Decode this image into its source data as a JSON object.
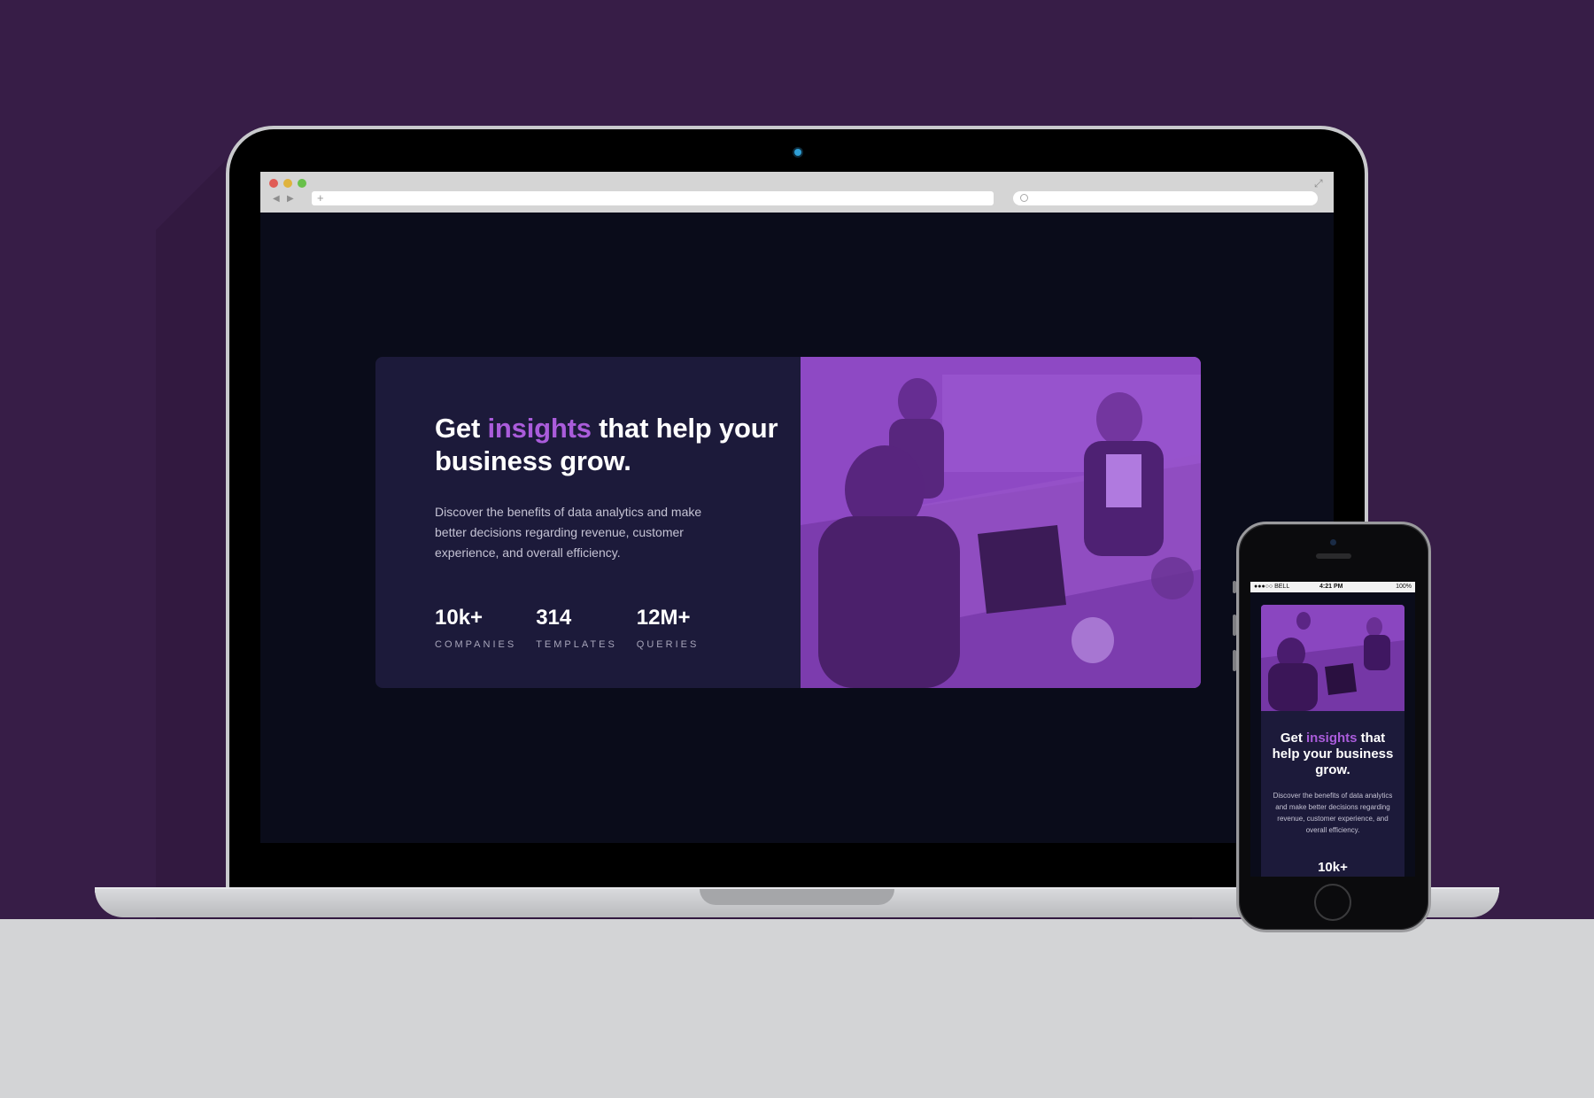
{
  "browser": {
    "url_plus": "+",
    "nav_back": "◀",
    "nav_forward": "▶",
    "expand": "⤢"
  },
  "card": {
    "headline_pre": "Get ",
    "headline_accent": "insights",
    "headline_post": " that help your business grow.",
    "description": "Discover the benefits of data analytics and make better decisions regarding revenue, customer experience, and overall efficiency.",
    "stats": [
      {
        "value": "10k+",
        "label": "COMPANIES"
      },
      {
        "value": "314",
        "label": "TEMPLATES"
      },
      {
        "value": "12M+",
        "label": "QUERIES"
      }
    ]
  },
  "phone": {
    "status_left": "●●●○○ BELL",
    "status_time": "4:21 PM",
    "status_right": "100%",
    "headline_pre": "Get ",
    "headline_accent": "insights",
    "headline_post": " that help your business grow.",
    "description": "Discover the benefits of data analytics and make better decisions regarding revenue, customer experience, and overall efficiency.",
    "first_stat": "10k+"
  },
  "colors": {
    "background": "#371d47",
    "card": "#1c1a3a",
    "accent": "#aa5cdb",
    "screen": "#0a0c1a",
    "floor": "#d3d4d6"
  },
  "icons": [
    "search-icon",
    "expand-icon",
    "camera-icon",
    "home-button-icon"
  ]
}
